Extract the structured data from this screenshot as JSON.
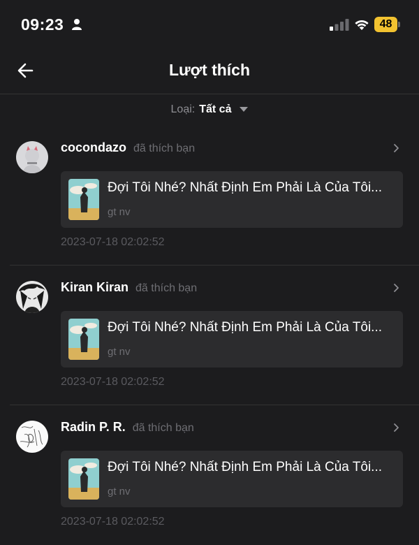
{
  "status_bar": {
    "time": "09:23",
    "battery": "48"
  },
  "nav": {
    "title": "Lượt thích"
  },
  "filter": {
    "label": "Loại:",
    "value": "Tất cả"
  },
  "items": [
    {
      "username": "cocondazo",
      "action": "đã thích bạn",
      "book_title": "Đợi Tôi Nhé? Nhất Định Em Phải Là Của Tôi...",
      "book_sub": "gt nv",
      "timestamp": "2023-07-18 02:02:52"
    },
    {
      "username": "Kiran Kiran",
      "action": "đã thích bạn",
      "book_title": "Đợi Tôi Nhé? Nhất Định Em Phải Là Của Tôi...",
      "book_sub": "gt nv",
      "timestamp": "2023-07-18 02:02:52"
    },
    {
      "username": "Radin P. R.",
      "action": "đã thích bạn",
      "book_title": "Đợi Tôi Nhé? Nhất Định Em Phải Là Của Tôi...",
      "book_sub": "gt nv",
      "timestamp": "2023-07-18 02:02:52"
    }
  ]
}
